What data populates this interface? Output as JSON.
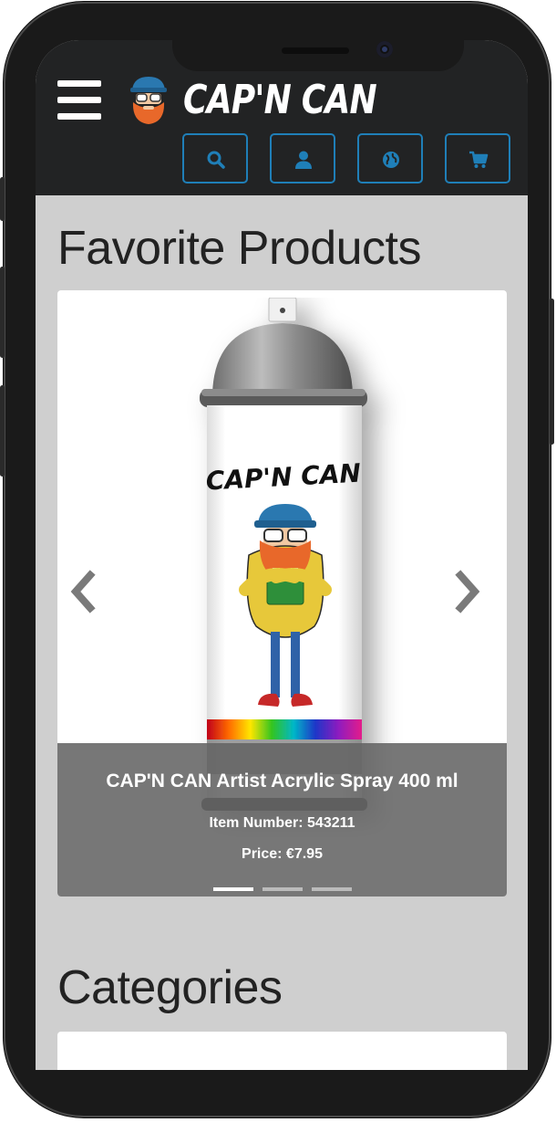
{
  "header": {
    "brand": "CAP'N CAN",
    "menu_icon": "hamburger-menu-icon",
    "actions": [
      {
        "icon": "search-icon"
      },
      {
        "icon": "user-icon"
      },
      {
        "icon": "globe-icon"
      },
      {
        "icon": "cart-icon"
      }
    ],
    "accent_color": "#1f7fb8"
  },
  "favorites": {
    "title": "Favorite Products",
    "slide": {
      "can_label": "CAP'N CAN",
      "product_name": "CAP'N CAN Artist Acrylic Spray 400 ml",
      "item_number": "Item Number: 543211",
      "price": "Price: €7.95"
    },
    "prev_icon": "chevron-left-icon",
    "next_icon": "chevron-right-icon",
    "indicators": 3,
    "active_indicator": 0
  },
  "categories": {
    "title": "Categories"
  }
}
